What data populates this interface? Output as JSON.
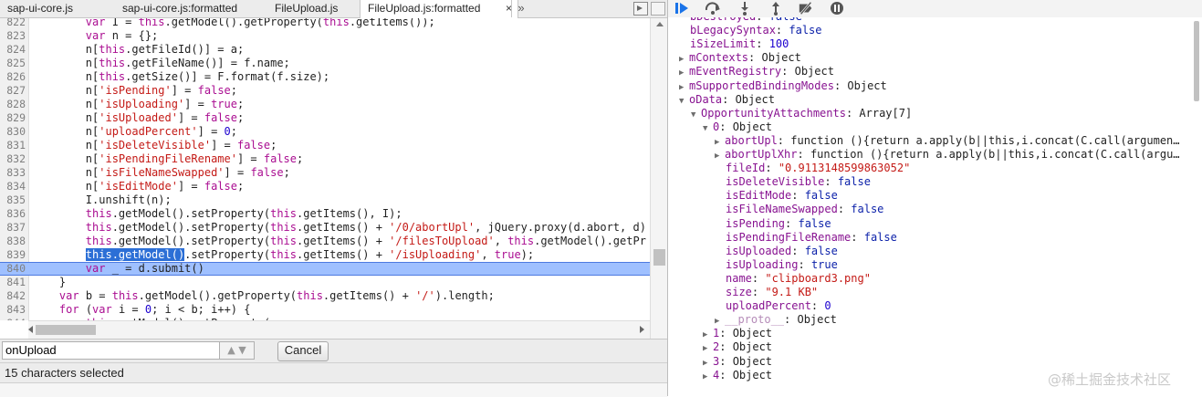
{
  "tabs": [
    {
      "label": "sap-ui-core.js",
      "closable": false
    },
    {
      "label": "sap-ui-core.js:formatted",
      "closable": false
    },
    {
      "label": "FileUpload.js",
      "closable": false
    },
    {
      "label": "FileUpload.js:formatted",
      "closable": true,
      "close_glyph": "×"
    }
  ],
  "tab_more_glyph": "»",
  "code_lines": [
    {
      "n": "822",
      "html": "        <span class=\"kw\">var</span> I = <span class=\"kw\">this</span>.getModel().getProperty(<span class=\"kw\">this</span>.getItems());"
    },
    {
      "n": "823",
      "html": "        <span class=\"kw\">var</span> n = {};"
    },
    {
      "n": "824",
      "html": "        n[<span class=\"kw\">this</span>.getFileId()] = a;"
    },
    {
      "n": "825",
      "html": "        n[<span class=\"kw\">this</span>.getFileName()] = f.name;"
    },
    {
      "n": "826",
      "html": "        n[<span class=\"kw\">this</span>.getSize()] = F.format(f.size);"
    },
    {
      "n": "827",
      "html": "        n[<span class=\"str\">'isPending'</span>] = <span class=\"kw\">false</span>;"
    },
    {
      "n": "828",
      "html": "        n[<span class=\"str\">'isUploading'</span>] = <span class=\"kw\">true</span>;"
    },
    {
      "n": "829",
      "html": "        n[<span class=\"str\">'isUploaded'</span>] = <span class=\"kw\">false</span>;"
    },
    {
      "n": "830",
      "html": "        n[<span class=\"str\">'uploadPercent'</span>] = <span class=\"num\">0</span>;"
    },
    {
      "n": "831",
      "html": "        n[<span class=\"str\">'isDeleteVisible'</span>] = <span class=\"kw\">false</span>;"
    },
    {
      "n": "832",
      "html": "        n[<span class=\"str\">'isPendingFileRename'</span>] = <span class=\"kw\">false</span>;"
    },
    {
      "n": "833",
      "html": "        n[<span class=\"str\">'isFileNameSwapped'</span>] = <span class=\"kw\">false</span>;"
    },
    {
      "n": "834",
      "html": "        n[<span class=\"str\">'isEditMode'</span>] = <span class=\"kw\">false</span>;"
    },
    {
      "n": "835",
      "html": "        I.unshift(n);"
    },
    {
      "n": "836",
      "html": "        <span class=\"kw\">this</span>.getModel().setProperty(<span class=\"kw\">this</span>.getItems(), I);"
    },
    {
      "n": "837",
      "html": "        <span class=\"kw\">this</span>.getModel().setProperty(<span class=\"kw\">this</span>.getItems() + <span class=\"str\">'/0/abortUpl'</span>, jQuery.proxy(d.abort, d)"
    },
    {
      "n": "838",
      "html": "        <span class=\"kw\">this</span>.getModel().setProperty(<span class=\"kw\">this</span>.getItems() + <span class=\"str\">'/filesToUpload'</span>, <span class=\"kw\">this</span>.getModel().getPr"
    },
    {
      "n": "839",
      "html": "        <span class=\"selhl\">this.getModel()</span>.setProperty(<span class=\"kw\">this</span>.getItems() + <span class=\"str\">'/isUploading'</span>, <span class=\"kw\">true</span>);"
    },
    {
      "n": "840",
      "html": "        <span class=\"kw\">var</span> _ = d.submit()",
      "exec": true
    },
    {
      "n": "841",
      "html": "    }"
    },
    {
      "n": "842",
      "html": "    <span class=\"kw\">var</span> b = <span class=\"kw\">this</span>.getModel().getProperty(<span class=\"kw\">this</span>.getItems() + <span class=\"str\">'/'</span>).length;"
    },
    {
      "n": "843",
      "html": "    <span class=\"kw\">for</span> (<span class=\"kw\">var</span> i = <span class=\"num\">0</span>; i &lt; b; i++) {"
    },
    {
      "n": "844",
      "html": "        <span class=\"kw\">this</span>.getModel().setProperty("
    }
  ],
  "search": {
    "value": "onUpload",
    "arrows": "▲ ▼"
  },
  "cancel_label": "Cancel",
  "status_text": "15 characters selected",
  "scope_rows": [
    {
      "indent": 0,
      "tri": "",
      "name": "bDestroyed",
      "sep": ": ",
      "value": "false",
      "vtype": "kw"
    },
    {
      "indent": 0,
      "tri": "",
      "name": "bLegacySyntax",
      "sep": ": ",
      "value": "false",
      "vtype": "kw"
    },
    {
      "indent": 0,
      "tri": "",
      "name": "iSizeLimit",
      "sep": ": ",
      "value": "100",
      "vtype": "num"
    },
    {
      "indent": 0,
      "tri": "▶",
      "name": "mContexts",
      "sep": ": ",
      "value": "Object",
      "vtype": "plain"
    },
    {
      "indent": 0,
      "tri": "▶",
      "name": "mEventRegistry",
      "sep": ": ",
      "value": "Object",
      "vtype": "plain"
    },
    {
      "indent": 0,
      "tri": "▶",
      "name": "mSupportedBindingModes",
      "sep": ": ",
      "value": "Object",
      "vtype": "plain"
    },
    {
      "indent": 0,
      "tri": "▼",
      "name": "oData",
      "sep": ": ",
      "value": "Object",
      "vtype": "plain"
    },
    {
      "indent": 1,
      "tri": "▼",
      "name": "OpportunityAttachments",
      "sep": ": ",
      "value": "Array[7]",
      "vtype": "plain"
    },
    {
      "indent": 2,
      "tri": "▼",
      "name": "0",
      "sep": ": ",
      "value": "Object",
      "vtype": "plain"
    },
    {
      "indent": 3,
      "tri": "▶",
      "name": "abortUpl",
      "sep": ": ",
      "value": "function (){return a.apply(b||this,i.concat(C.call(argumen…",
      "vtype": "plain"
    },
    {
      "indent": 3,
      "tri": "▶",
      "name": "abortUplXhr",
      "sep": ": ",
      "value": "function (){return a.apply(b||this,i.concat(C.call(argu…",
      "vtype": "plain"
    },
    {
      "indent": 3,
      "tri": "",
      "name": "fileId",
      "sep": ": ",
      "value": "\"0.9113148599863052\"",
      "vtype": "str"
    },
    {
      "indent": 3,
      "tri": "",
      "name": "isDeleteVisible",
      "sep": ": ",
      "value": "false",
      "vtype": "kw"
    },
    {
      "indent": 3,
      "tri": "",
      "name": "isEditMode",
      "sep": ": ",
      "value": "false",
      "vtype": "kw"
    },
    {
      "indent": 3,
      "tri": "",
      "name": "isFileNameSwapped",
      "sep": ": ",
      "value": "false",
      "vtype": "kw"
    },
    {
      "indent": 3,
      "tri": "",
      "name": "isPending",
      "sep": ": ",
      "value": "false",
      "vtype": "kw"
    },
    {
      "indent": 3,
      "tri": "",
      "name": "isPendingFileRename",
      "sep": ": ",
      "value": "false",
      "vtype": "kw"
    },
    {
      "indent": 3,
      "tri": "",
      "name": "isUploaded",
      "sep": ": ",
      "value": "false",
      "vtype": "kw"
    },
    {
      "indent": 3,
      "tri": "",
      "name": "isUploading",
      "sep": ": ",
      "value": "true",
      "vtype": "kw"
    },
    {
      "indent": 3,
      "tri": "",
      "name": "name",
      "sep": ": ",
      "value": "\"clipboard3.png\"",
      "vtype": "str"
    },
    {
      "indent": 3,
      "tri": "",
      "name": "size",
      "sep": ": ",
      "value": "\"9.1 KB\"",
      "vtype": "str"
    },
    {
      "indent": 3,
      "tri": "",
      "name": "uploadPercent",
      "sep": ": ",
      "value": "0",
      "vtype": "num"
    },
    {
      "indent": 3,
      "tri": "▶",
      "name": "__proto__",
      "sep": ": ",
      "value": "Object",
      "vtype": "plain",
      "proto": true
    },
    {
      "indent": 2,
      "tri": "▶",
      "name": "1",
      "sep": ": ",
      "value": "Object",
      "vtype": "plain"
    },
    {
      "indent": 2,
      "tri": "▶",
      "name": "2",
      "sep": ": ",
      "value": "Object",
      "vtype": "plain"
    },
    {
      "indent": 2,
      "tri": "▶",
      "name": "3",
      "sep": ": ",
      "value": "Object",
      "vtype": "plain"
    },
    {
      "indent": 2,
      "tri": "▶",
      "name": "4",
      "sep": ": ",
      "value": "Object",
      "vtype": "plain"
    }
  ],
  "watermark": "@稀土掘金技术社区",
  "colors": {
    "accent": "#2c6fd6",
    "exec_line": "#9fc0ff",
    "resume": "#1a73e8"
  }
}
